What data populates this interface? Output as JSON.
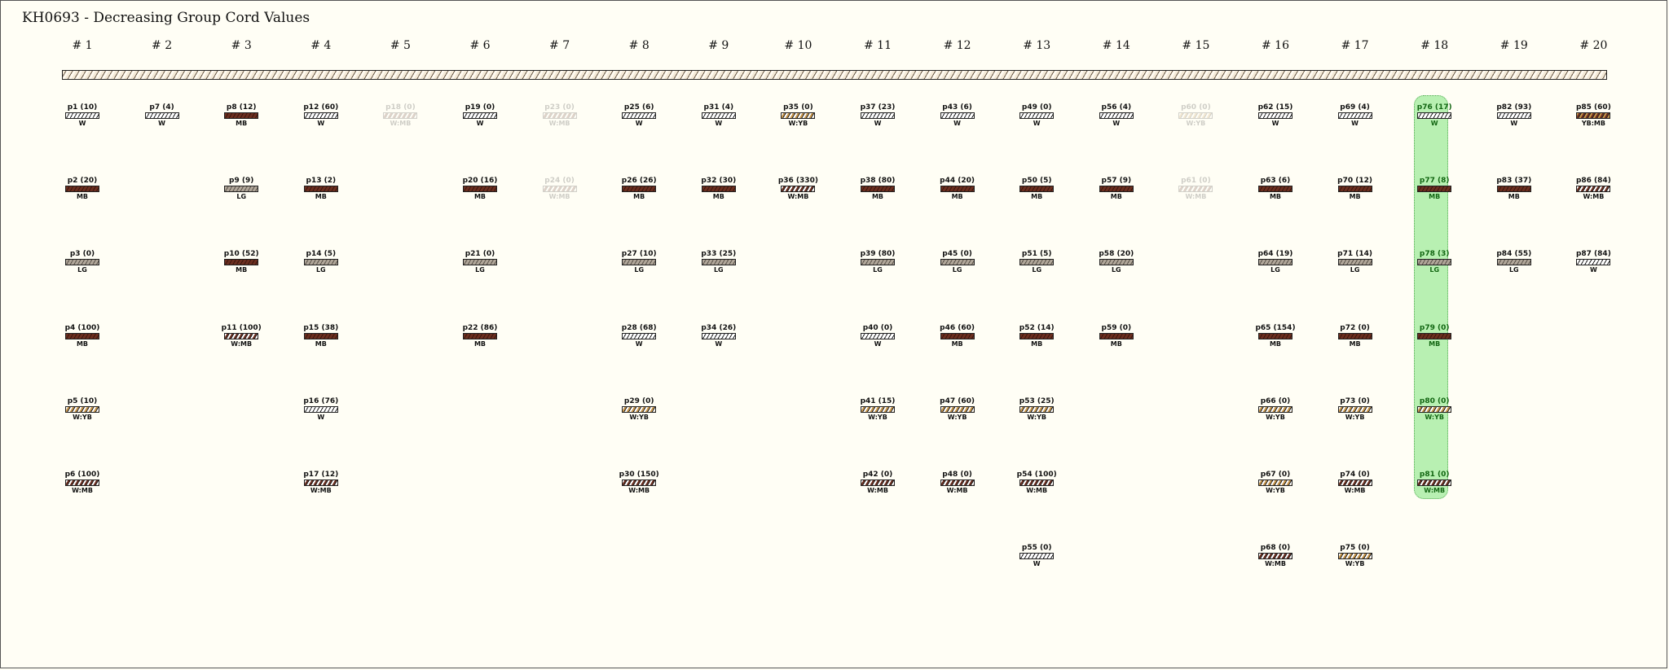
{
  "title": "KH0693 - Decreasing Group Cord Values",
  "groups": [
    "# 1",
    "# 2",
    "# 3",
    "# 4",
    "# 5",
    "# 6",
    "# 7",
    "# 8",
    "# 9",
    "# 10",
    "# 11",
    "# 12",
    "# 13",
    "# 14",
    "# 15",
    "# 16",
    "# 17",
    "# 18",
    "# 19",
    "# 20"
  ],
  "highlight_group": 18,
  "colors": {
    "background": "#fffef5",
    "highlight": "#b8f0b2",
    "highlight_text": "#126612",
    "MB": "#6b2e1f",
    "LG": "#b0a699",
    "YB": "#c8964a",
    "W": "#ffffff"
  },
  "cords": [
    {
      "id": "p1",
      "label": "p1 (10)",
      "group": 1,
      "row": 1,
      "color": "W"
    },
    {
      "id": "p2",
      "label": "p2 (20)",
      "group": 1,
      "row": 2,
      "color": "MB"
    },
    {
      "id": "p3",
      "label": "p3 (0)",
      "group": 1,
      "row": 3,
      "color": "LG"
    },
    {
      "id": "p4",
      "label": "p4 (100)",
      "group": 1,
      "row": 4,
      "color": "MB"
    },
    {
      "id": "p5",
      "label": "p5 (10)",
      "group": 1,
      "row": 5,
      "color": "W:YB"
    },
    {
      "id": "p6",
      "label": "p6 (100)",
      "group": 1,
      "row": 6,
      "color": "W:MB"
    },
    {
      "id": "p7",
      "label": "p7 (4)",
      "group": 2,
      "row": 1,
      "color": "W"
    },
    {
      "id": "p8",
      "label": "p8 (12)",
      "group": 3,
      "row": 1,
      "color": "MB"
    },
    {
      "id": "p9",
      "label": "p9 (9)",
      "group": 3,
      "row": 2,
      "color": "LG"
    },
    {
      "id": "p10",
      "label": "p10 (52)",
      "group": 3,
      "row": 3,
      "color": "MB"
    },
    {
      "id": "p11",
      "label": "p11 (100)",
      "group": 3,
      "row": 4,
      "color": "W:MB"
    },
    {
      "id": "p12",
      "label": "p12 (60)",
      "group": 4,
      "row": 1,
      "color": "W"
    },
    {
      "id": "p13",
      "label": "p13 (2)",
      "group": 4,
      "row": 2,
      "color": "MB"
    },
    {
      "id": "p14",
      "label": "p14 (5)",
      "group": 4,
      "row": 3,
      "color": "LG"
    },
    {
      "id": "p15",
      "label": "p15 (38)",
      "group": 4,
      "row": 4,
      "color": "MB"
    },
    {
      "id": "p16",
      "label": "p16 (76)",
      "group": 4,
      "row": 5,
      "color": "W"
    },
    {
      "id": "p17",
      "label": "p17 (12)",
      "group": 4,
      "row": 6,
      "color": "W:MB"
    },
    {
      "id": "p18",
      "label": "p18 (0)",
      "group": 5,
      "row": 1,
      "color": "W:MB",
      "faded": true
    },
    {
      "id": "p19",
      "label": "p19 (0)",
      "group": 6,
      "row": 1,
      "color": "W"
    },
    {
      "id": "p20",
      "label": "p20 (16)",
      "group": 6,
      "row": 2,
      "color": "MB"
    },
    {
      "id": "p21",
      "label": "p21 (0)",
      "group": 6,
      "row": 3,
      "color": "LG"
    },
    {
      "id": "p22",
      "label": "p22 (86)",
      "group": 6,
      "row": 4,
      "color": "MB"
    },
    {
      "id": "p23",
      "label": "p23 (0)",
      "group": 7,
      "row": 1,
      "color": "W:MB",
      "faded": true
    },
    {
      "id": "p24",
      "label": "p24 (0)",
      "group": 7,
      "row": 2,
      "color": "W:MB",
      "faded": true
    },
    {
      "id": "p25",
      "label": "p25 (6)",
      "group": 8,
      "row": 1,
      "color": "W"
    },
    {
      "id": "p26",
      "label": "p26 (26)",
      "group": 8,
      "row": 2,
      "color": "MB"
    },
    {
      "id": "p27",
      "label": "p27 (10)",
      "group": 8,
      "row": 3,
      "color": "LG"
    },
    {
      "id": "p28",
      "label": "p28 (68)",
      "group": 8,
      "row": 4,
      "color": "W"
    },
    {
      "id": "p29",
      "label": "p29 (0)",
      "group": 8,
      "row": 5,
      "color": "W:YB"
    },
    {
      "id": "p30",
      "label": "p30 (150)",
      "group": 8,
      "row": 6,
      "color": "W:MB"
    },
    {
      "id": "p31",
      "label": "p31 (4)",
      "group": 9,
      "row": 1,
      "color": "W"
    },
    {
      "id": "p32",
      "label": "p32 (30)",
      "group": 9,
      "row": 2,
      "color": "MB"
    },
    {
      "id": "p33",
      "label": "p33 (25)",
      "group": 9,
      "row": 3,
      "color": "LG"
    },
    {
      "id": "p34",
      "label": "p34 (26)",
      "group": 9,
      "row": 4,
      "color": "W"
    },
    {
      "id": "p35",
      "label": "p35 (0)",
      "group": 10,
      "row": 1,
      "color": "W:YB"
    },
    {
      "id": "p36",
      "label": "p36 (330)",
      "group": 10,
      "row": 2,
      "color": "W:MB"
    },
    {
      "id": "p37",
      "label": "p37 (23)",
      "group": 11,
      "row": 1,
      "color": "W"
    },
    {
      "id": "p38",
      "label": "p38 (80)",
      "group": 11,
      "row": 2,
      "color": "MB"
    },
    {
      "id": "p39",
      "label": "p39 (80)",
      "group": 11,
      "row": 3,
      "color": "LG"
    },
    {
      "id": "p40",
      "label": "p40 (0)",
      "group": 11,
      "row": 4,
      "color": "W"
    },
    {
      "id": "p41",
      "label": "p41 (15)",
      "group": 11,
      "row": 5,
      "color": "W:YB"
    },
    {
      "id": "p42",
      "label": "p42 (0)",
      "group": 11,
      "row": 6,
      "color": "W:MB"
    },
    {
      "id": "p43",
      "label": "p43 (6)",
      "group": 12,
      "row": 1,
      "color": "W"
    },
    {
      "id": "p44",
      "label": "p44 (20)",
      "group": 12,
      "row": 2,
      "color": "MB"
    },
    {
      "id": "p45",
      "label": "p45 (0)",
      "group": 12,
      "row": 3,
      "color": "LG"
    },
    {
      "id": "p46",
      "label": "p46 (60)",
      "group": 12,
      "row": 4,
      "color": "MB"
    },
    {
      "id": "p47",
      "label": "p47 (60)",
      "group": 12,
      "row": 5,
      "color": "W:YB"
    },
    {
      "id": "p48",
      "label": "p48 (0)",
      "group": 12,
      "row": 6,
      "color": "W:MB"
    },
    {
      "id": "p49",
      "label": "p49 (0)",
      "group": 13,
      "row": 1,
      "color": "W"
    },
    {
      "id": "p50",
      "label": "p50 (5)",
      "group": 13,
      "row": 2,
      "color": "MB"
    },
    {
      "id": "p51",
      "label": "p51 (5)",
      "group": 13,
      "row": 3,
      "color": "LG"
    },
    {
      "id": "p52",
      "label": "p52 (14)",
      "group": 13,
      "row": 4,
      "color": "MB"
    },
    {
      "id": "p53",
      "label": "p53 (25)",
      "group": 13,
      "row": 5,
      "color": "W:YB"
    },
    {
      "id": "p54",
      "label": "p54 (100)",
      "group": 13,
      "row": 6,
      "color": "W:MB"
    },
    {
      "id": "p55",
      "label": "p55 (0)",
      "group": 13,
      "row": 7,
      "color": "W"
    },
    {
      "id": "p56",
      "label": "p56 (4)",
      "group": 14,
      "row": 1,
      "color": "W"
    },
    {
      "id": "p57",
      "label": "p57 (9)",
      "group": 14,
      "row": 2,
      "color": "MB"
    },
    {
      "id": "p58",
      "label": "p58 (20)",
      "group": 14,
      "row": 3,
      "color": "LG"
    },
    {
      "id": "p59",
      "label": "p59 (0)",
      "group": 14,
      "row": 4,
      "color": "MB"
    },
    {
      "id": "p60",
      "label": "p60 (0)",
      "group": 15,
      "row": 1,
      "color": "W:YB",
      "faded": true
    },
    {
      "id": "p61",
      "label": "p61 (0)",
      "group": 15,
      "row": 2,
      "color": "W:MB",
      "faded": true
    },
    {
      "id": "p62",
      "label": "p62 (15)",
      "group": 16,
      "row": 1,
      "color": "W"
    },
    {
      "id": "p63",
      "label": "p63 (6)",
      "group": 16,
      "row": 2,
      "color": "MB"
    },
    {
      "id": "p64",
      "label": "p64 (19)",
      "group": 16,
      "row": 3,
      "color": "LG"
    },
    {
      "id": "p65",
      "label": "p65 (154)",
      "group": 16,
      "row": 4,
      "color": "MB"
    },
    {
      "id": "p66",
      "label": "p66 (0)",
      "group": 16,
      "row": 5,
      "color": "W:YB"
    },
    {
      "id": "p67",
      "label": "p67 (0)",
      "group": 16,
      "row": 6,
      "color": "W:YB"
    },
    {
      "id": "p68",
      "label": "p68 (0)",
      "group": 16,
      "row": 7,
      "color": "W:MB"
    },
    {
      "id": "p69",
      "label": "p69 (4)",
      "group": 17,
      "row": 1,
      "color": "W"
    },
    {
      "id": "p70",
      "label": "p70 (12)",
      "group": 17,
      "row": 2,
      "color": "MB"
    },
    {
      "id": "p71",
      "label": "p71 (14)",
      "group": 17,
      "row": 3,
      "color": "LG"
    },
    {
      "id": "p72",
      "label": "p72 (0)",
      "group": 17,
      "row": 4,
      "color": "MB"
    },
    {
      "id": "p73",
      "label": "p73 (0)",
      "group": 17,
      "row": 5,
      "color": "W:YB"
    },
    {
      "id": "p74",
      "label": "p74 (0)",
      "group": 17,
      "row": 6,
      "color": "W:MB"
    },
    {
      "id": "p75",
      "label": "p75 (0)",
      "group": 17,
      "row": 7,
      "color": "W:YB"
    },
    {
      "id": "p76",
      "label": "p76 (17)",
      "group": 18,
      "row": 1,
      "color": "W"
    },
    {
      "id": "p77",
      "label": "p77 (8)",
      "group": 18,
      "row": 2,
      "color": "MB"
    },
    {
      "id": "p78",
      "label": "p78 (3)",
      "group": 18,
      "row": 3,
      "color": "LG"
    },
    {
      "id": "p79",
      "label": "p79 (0)",
      "group": 18,
      "row": 4,
      "color": "MB"
    },
    {
      "id": "p80",
      "label": "p80 (0)",
      "group": 18,
      "row": 5,
      "color": "W:YB"
    },
    {
      "id": "p81",
      "label": "p81 (0)",
      "group": 18,
      "row": 6,
      "color": "W:MB"
    },
    {
      "id": "p82",
      "label": "p82 (93)",
      "group": 19,
      "row": 1,
      "color": "W"
    },
    {
      "id": "p83",
      "label": "p83 (37)",
      "group": 19,
      "row": 2,
      "color": "MB"
    },
    {
      "id": "p84",
      "label": "p84 (55)",
      "group": 19,
      "row": 3,
      "color": "LG"
    },
    {
      "id": "p85",
      "label": "p85 (60)",
      "group": 20,
      "row": 1,
      "color": "YB:MB"
    },
    {
      "id": "p86",
      "label": "p86 (84)",
      "group": 20,
      "row": 2,
      "color": "W:MB"
    },
    {
      "id": "p87",
      "label": "p87 (84)",
      "group": 20,
      "row": 3,
      "color": "W"
    }
  ]
}
